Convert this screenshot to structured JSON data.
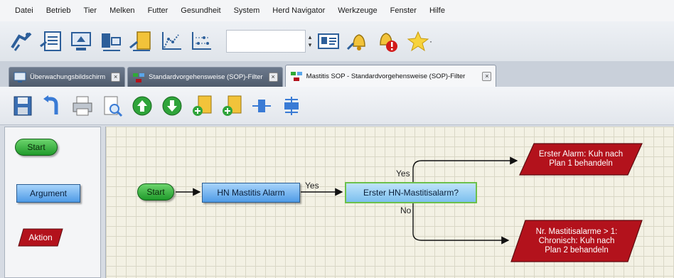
{
  "menu": [
    "Datei",
    "Betrieb",
    "Tier",
    "Melken",
    "Futter",
    "Gesundheit",
    "System",
    "Herd Navigator",
    "Werkzeuge",
    "Fenster",
    "Hilfe"
  ],
  "toolbar": {
    "icons": [
      "walk-icon",
      "list-icon",
      "monitor-icon",
      "computer-network-icon",
      "cow-folder-icon",
      "chart-icon",
      "scatter-chart-icon"
    ],
    "input_value": "",
    "alarm_icons": [
      "bell-icon",
      "bell-alert-icon",
      "star-icon"
    ]
  },
  "tabs": [
    {
      "label": "Überwachungsbildschirm",
      "active": false
    },
    {
      "label": "Standardvorgehensweise (SOP)-Filter",
      "active": false
    },
    {
      "label": "Mastitis SOP - Standardvorgehensweise (SOP)-Filter",
      "active": true
    }
  ],
  "toolbar2": {
    "icons": [
      "save-icon",
      "undo-icon",
      "print-icon",
      "print-preview-icon",
      "arrow-up-icon",
      "arrow-down-icon",
      "insert-action-icon",
      "insert-node-icon",
      "align-horizontal-icon",
      "align-vertical-icon"
    ]
  },
  "palette": {
    "start": "Start",
    "argument": "Argument",
    "action": "Aktion"
  },
  "flow": {
    "start": "Start",
    "argument": "HN Mastitis Alarm",
    "edge_yes_1": "Yes",
    "decision": "Erster HN-Mastitisalarm?",
    "edge_yes_2": "Yes",
    "edge_no": "No",
    "action_1": "Erster Alarm: Kuh nach Plan 1 behandeln",
    "action_2": "Nr. Mastitisalarme > 1: Chronisch: Kuh nach Plan 2 behandeln"
  },
  "colors": {
    "start_green": "#2faa35",
    "argument_blue": "#5aa6ea",
    "action_red": "#b3121c",
    "decision_border": "#6cc04a"
  }
}
